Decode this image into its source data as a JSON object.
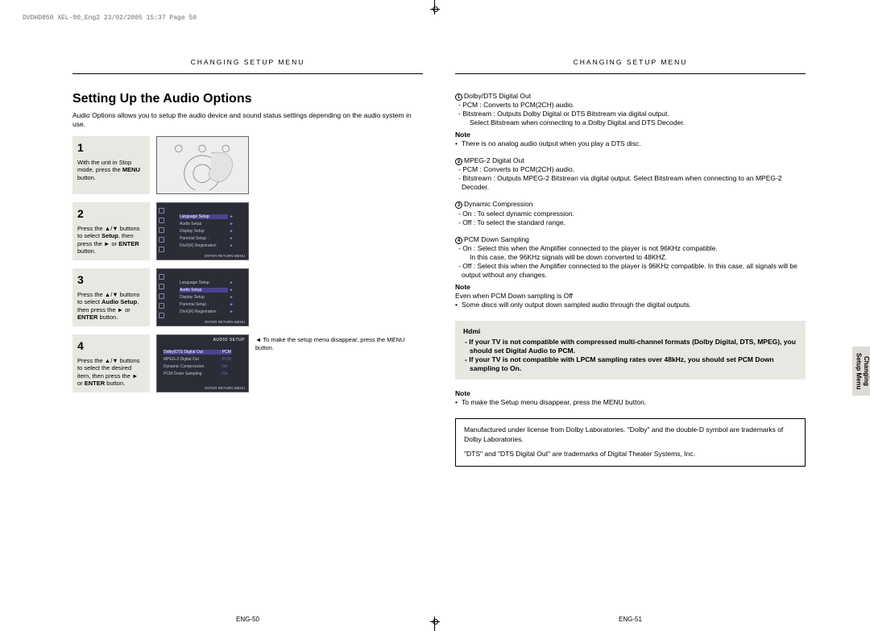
{
  "doc_header": "DVDHD850 XEL-00_Eng2  23/02/2005  15:37  Page 50",
  "section_header_left": "CHANGING SETUP MENU",
  "section_header_right": "CHANGING SETUP MENU",
  "title": "Setting Up the Audio Options",
  "intro": "Audio Options allows you to setup the audio device and sound status settings depending on the audio system in use.",
  "steps": {
    "s1": {
      "num": "1",
      "text_a": "With the unit in Stop mode, press the ",
      "text_b": "MENU",
      "text_c": " button."
    },
    "s2": {
      "num": "2",
      "text_a": "Press the ▲/▼ buttons to select ",
      "text_b": "Setup",
      "text_c": ", then press the ► or ",
      "text_d": "ENTER",
      "text_e": " button."
    },
    "s3": {
      "num": "3",
      "text_a": "Press the ▲/▼ buttons to select ",
      "text_b": "Audio Setup",
      "text_c": ", then press the ► or ",
      "text_d": "ENTER",
      "text_e": " button."
    },
    "s4": {
      "num": "4",
      "text_a": "Press the ▲/▼ buttons to select the desired item, then press the ► or ",
      "text_b": "ENTER",
      "text_c": " button."
    }
  },
  "step4_note": "◄ To make the setup menu disappear, press the MENU button.",
  "setup_menu": {
    "rows": [
      {
        "label": "Language Setup",
        "val": "",
        "arrow": "►"
      },
      {
        "label": "Audio Setup",
        "val": "",
        "arrow": "►"
      },
      {
        "label": "Display Setup",
        "val": "",
        "arrow": "►"
      },
      {
        "label": "Parental Setup :",
        "val": "",
        "arrow": "►"
      },
      {
        "label": "DivX(R) Registration",
        "val": "",
        "arrow": "►"
      }
    ],
    "footer": "ENTER   RETURN   MENU"
  },
  "audio_menu": {
    "title": "AUDIO SETUP",
    "rows": [
      {
        "label": "Dolby/DTS Digital Out",
        "val": ": PCM"
      },
      {
        "label": "MPEG-2 Digital Out",
        "val": ": PCM"
      },
      {
        "label": "Dynamic Compression",
        "val": ": On"
      },
      {
        "label": "PCM Down Sampling",
        "val": ": On"
      }
    ],
    "footer": "ENTER   RETURN   MENU"
  },
  "right": {
    "i1": {
      "head": "Dolby/DTS Digital Out",
      "l1": "- PCM : Converts to PCM(2CH) audio.",
      "l2": "- Bitstream : Outputs Dolby Digital or DTS Bitstream via digital output.",
      "l3": "Select Bitstream when connecting to a Dolby Digital and DTS Decoder.",
      "note_lbl": "Note",
      "note": "There is no analog audio output when you play a DTS disc."
    },
    "i2": {
      "head": "MPEG-2 Digital Out",
      "l1": "- PCM : Converts to PCM(2CH) audio.",
      "l2": "- Bitstream : Outputs MPEG-2 Bitstrean via digital output. Select Bitstream when connecting to an MPEG-2 Decoder."
    },
    "i3": {
      "head": "Dynamic Compression",
      "l1": "- On : To select dynamic compression.",
      "l2": "- Off : To select the standard range."
    },
    "i4": {
      "head": "PCM Down Sampling",
      "l1": "- On : Select this when the Amplifier connected to the player is not 96KHz compatible.",
      "l1b": "In this case, the 96KHz signals will be down converted to 48KHZ.",
      "l2": "- Off : Select this when the Amplifier connected to the player is 96KHz compatible. In this case, all signals will be output without any changes.",
      "note_lbl": "Note",
      "note1": "Even when PCM Down sampling is Off",
      "note2": "Some discs will only output down sampled audio through the digital outputs."
    },
    "hdmi": {
      "head": "Hdmi",
      "l1": "If your TV is not compatible with compressed multi-channel formats (Dolby Digital, DTS, MPEG), you should set Digital Audio to PCM.",
      "l2": "If your TV is not compatible with LPCM sampling rates over 48kHz, you should set PCM Down sampling to On."
    },
    "final_note_lbl": "Note",
    "final_note": "To make the Setup menu disappear, press the MENU button.",
    "dolby1": "Manufactured under license from Dolby Laboratories. \"Dolby\" and the double-D symbol are trademarks of Dolby Laboratories.",
    "dolby2": "\"DTS\" and \"DTS Digital Out\" are trademarks of Digital Theater Systems, Inc."
  },
  "page_num_left": "ENG-50",
  "page_num_right": "ENG-51",
  "side_tab_l1": "Changing",
  "side_tab_l2": "Setup Menu"
}
